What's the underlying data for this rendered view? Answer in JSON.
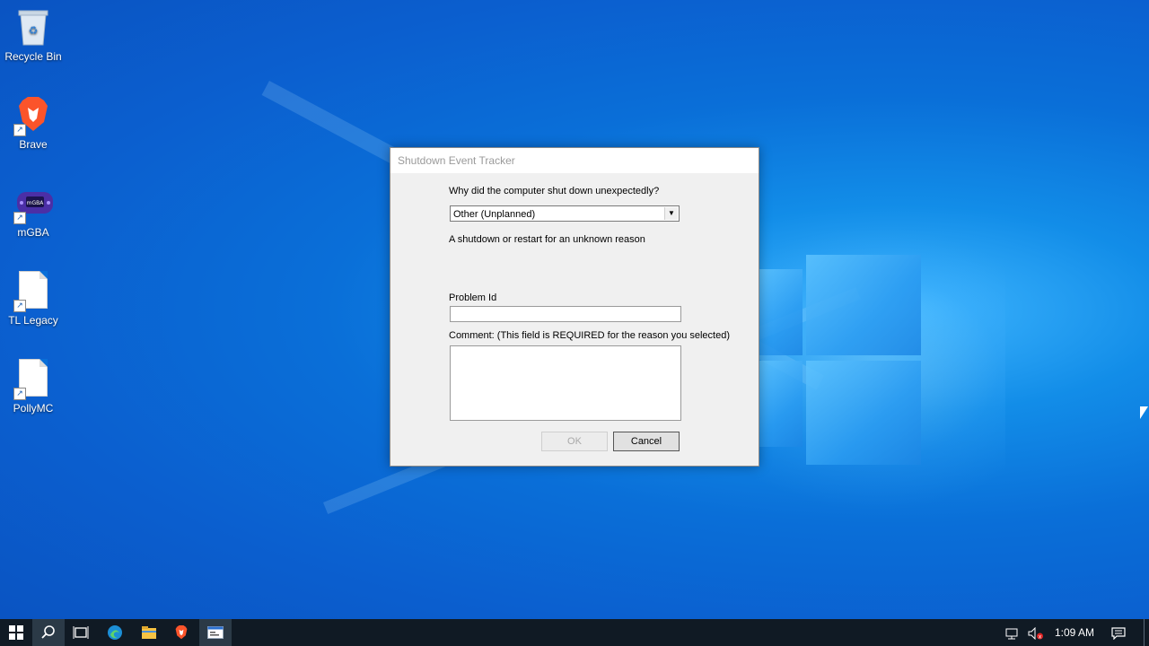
{
  "desktop": {
    "icons": [
      {
        "label": "Recycle Bin",
        "icon": "recycle-bin-icon"
      },
      {
        "label": "Brave",
        "icon": "brave-icon"
      },
      {
        "label": "mGBA",
        "icon": "mgba-icon"
      },
      {
        "label": "TL Legacy",
        "icon": "file-icon"
      },
      {
        "label": "PollyMC",
        "icon": "file-icon"
      }
    ]
  },
  "dialog": {
    "title": "Shutdown Event Tracker",
    "question": "Why did the computer shut down unexpectedly?",
    "reason_selected": "Other (Unplanned)",
    "reason_description": "A shutdown or restart for an unknown reason",
    "problem_id_label": "Problem Id",
    "problem_id_value": "",
    "comment_label": "Comment: (This field is REQUIRED for the reason you selected)",
    "comment_value": "",
    "ok_label": "OK",
    "cancel_label": "Cancel"
  },
  "taskbar": {
    "icons": [
      "windows-start-icon",
      "search-icon",
      "task-view-icon",
      "edge-icon",
      "file-explorer-icon",
      "brave-icon",
      "shutdown-tracker-icon"
    ],
    "clock": "1:09 AM",
    "tray_icons": [
      "network-icon",
      "volume-muted-icon",
      "notifications-icon"
    ]
  },
  "colors": {
    "desktop_bg": "#0a6fd8",
    "taskbar_bg": "#101a24",
    "dialog_bg": "#f0f0f0"
  }
}
